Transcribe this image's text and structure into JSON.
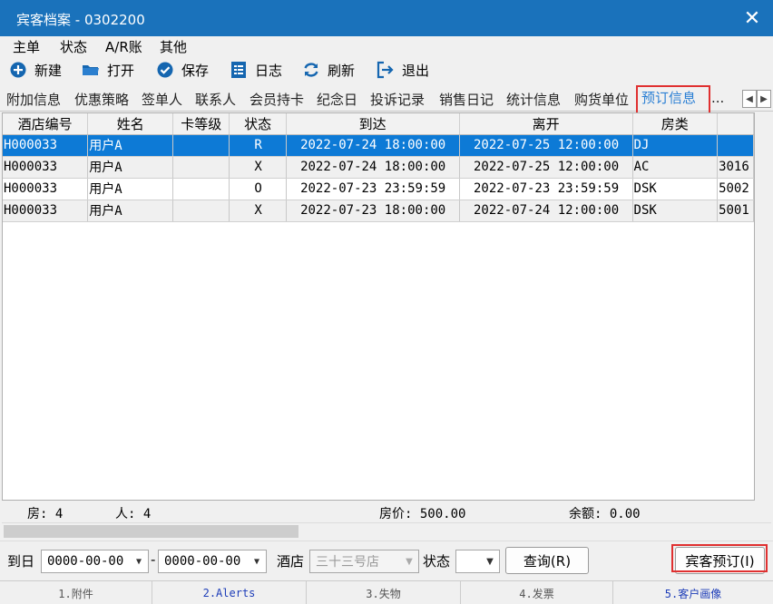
{
  "window": {
    "title": "宾客档案 - 0302200"
  },
  "menu": [
    "主单",
    "状态",
    "A/R账",
    "其他"
  ],
  "toolbar": {
    "new": "新建",
    "open": "打开",
    "save": "保存",
    "log": "日志",
    "refresh": "刷新",
    "exit": "退出"
  },
  "tabs": [
    "附加信息",
    "优惠策略",
    "签单人",
    "联系人",
    "会员持卡",
    "纪念日",
    "投诉记录",
    "销售日记",
    "统计信息",
    "购货单位",
    "预订信息",
    "..."
  ],
  "active_tab": "预订信息",
  "grid": {
    "columns": [
      "酒店编号",
      "姓名",
      "卡等级",
      "状态",
      "到达",
      "离开",
      "房类",
      ""
    ],
    "rows": [
      {
        "hotel": "H000033",
        "name": "用户A",
        "level": "",
        "status": "R",
        "arrive": "2022-07-24 18:00:00",
        "depart": "2022-07-25 12:00:00",
        "room_type": "DJ",
        "extra": ""
      },
      {
        "hotel": "H000033",
        "name": "用户A",
        "level": "",
        "status": "X",
        "arrive": "2022-07-24 18:00:00",
        "depart": "2022-07-25 12:00:00",
        "room_type": "AC",
        "extra": "3016"
      },
      {
        "hotel": "H000033",
        "name": "用户A",
        "level": "",
        "status": "O",
        "arrive": "2022-07-23 23:59:59",
        "depart": "2022-07-23 23:59:59",
        "room_type": "DSK",
        "extra": "5002"
      },
      {
        "hotel": "H000033",
        "name": "用户A",
        "level": "",
        "status": "X",
        "arrive": "2022-07-23 18:00:00",
        "depart": "2022-07-24 12:00:00",
        "room_type": "DSK",
        "extra": "5001"
      }
    ]
  },
  "summary": {
    "rooms": "房: 4",
    "people": "人: 4",
    "price": "房价: 500.00",
    "balance": "余额: 0.00"
  },
  "filters": {
    "date_label": "到日",
    "date_from": "0000-00-00",
    "separator": "-",
    "date_to": "0000-00-00",
    "hotel_label": "酒店",
    "hotel_value": "三十三号店",
    "status_label": "状态",
    "status_value": "",
    "query_button": "查询(R)",
    "reserve_button": "宾客预订(I)"
  },
  "statusbar": [
    "1.附件",
    "2.Alerts",
    "3.失物",
    "4.发票",
    "5.客户画像"
  ],
  "colors": {
    "titlebar": "#1a72bb",
    "selection": "#0d7ad6",
    "highlight": "#e03030",
    "active_tab": "#2a7fd4"
  }
}
